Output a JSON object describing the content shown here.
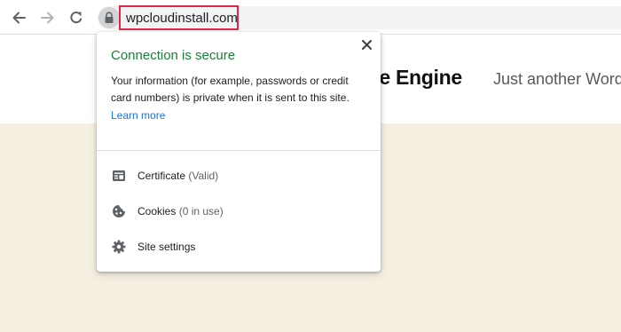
{
  "toolbar": {
    "back_icon": "arrow-left",
    "forward_icon": "arrow-right",
    "reload_icon": "reload",
    "lock_icon": "lock",
    "url": "wpcloudinstall.com"
  },
  "page": {
    "site_title": "te Engine",
    "site_tagline": "Just another Word",
    "body_color": "#f4efe0"
  },
  "site_info_popup": {
    "title": "Connection is secure",
    "title_color": "#188038",
    "description": "Your information (for example, passwords or credit card numbers) is private when it is sent to this site.",
    "learn_more": "Learn more",
    "close_icon": "close",
    "items": [
      {
        "icon": "certificate",
        "label": "Certificate",
        "detail": "(Valid)"
      },
      {
        "icon": "cookie",
        "label": "Cookies",
        "detail": "(0 in use)"
      },
      {
        "icon": "gear",
        "label": "Site settings",
        "detail": ""
      }
    ]
  }
}
